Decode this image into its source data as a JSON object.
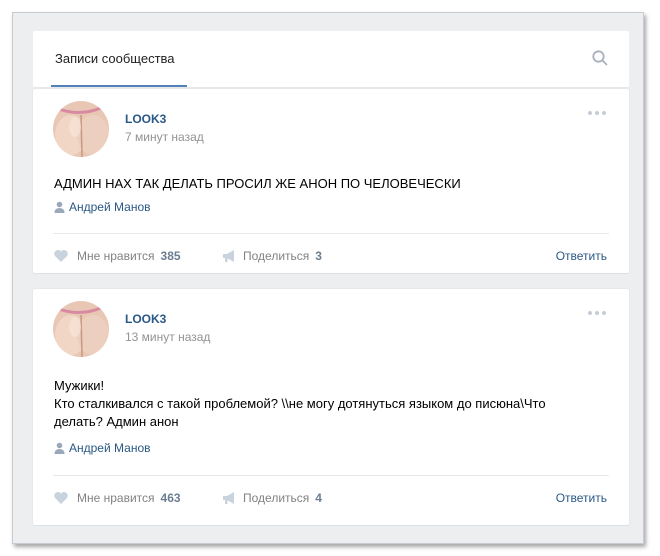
{
  "header": {
    "tab_label": "Записи сообщества"
  },
  "posts": [
    {
      "author": "LOOK3",
      "time": "7 минут назад",
      "text_lines": [
        "АДМИН НАХ ТАК ДЕЛАТЬ ПРОСИЛ ЖЕ АНОН ПО ЧЕЛОВЕЧЕСКИ"
      ],
      "signer": "Андрей Манов",
      "like_label": "Мне нравится",
      "like_count": "385",
      "share_label": "Поделиться",
      "share_count": "3",
      "reply_label": "Ответить"
    },
    {
      "author": "LOOK3",
      "time": "13 минут назад",
      "text_lines": [
        "Мужики!",
        "Кто сталкивался с такой проблемой? \\\\не могу дотянуться языком до писюна\\Что",
        "делать? Админ анон"
      ],
      "signer": "Андрей Манов",
      "like_label": "Мне нравится",
      "like_count": "463",
      "share_label": "Поделиться",
      "share_count": "4",
      "reply_label": "Ответить"
    }
  ],
  "icons": {
    "search": "search-icon",
    "more": "more-icon",
    "user": "user-icon",
    "like": "heart-icon",
    "share": "megaphone-icon"
  },
  "colors": {
    "link": "#2a5885",
    "accent": "#5181b8",
    "background": "#edeef0"
  }
}
